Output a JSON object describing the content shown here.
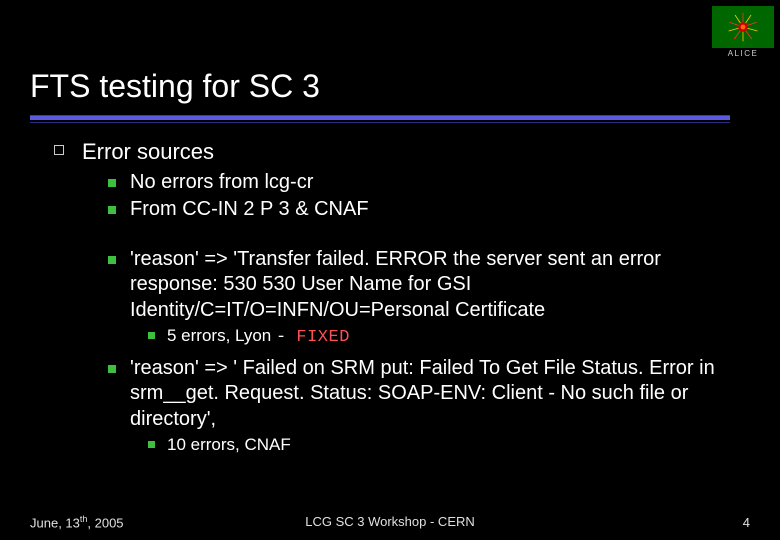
{
  "logo_text": "ALICE",
  "title": "FTS testing for SC 3",
  "lvl1_text": "Error sources",
  "points": {
    "p0": "No errors from lcg-cr",
    "p1": "From CC-IN 2 P 3 & CNAF",
    "p2": "'reason' => 'Transfer failed. ERROR the server sent an error response: 530 530 User Name for GSI Identity/C=IT/O=INFN/OU=Personal Certificate",
    "p2_sub_a": "5 errors, Lyon ",
    "p2_sub_sep": "- ",
    "p2_sub_b": "FIXED",
    "p3": "'reason' => ' Failed on SRM put: Failed To Get File Status. Error in srm__get. Request. Status: SOAP-ENV: Client - No such file or directory',",
    "p3_sub": "10 errors, CNAF"
  },
  "footer": {
    "left_pre": "June, 13",
    "left_sup": "th",
    "left_post": ", 2005",
    "center": "LCG SC 3 Workshop - CERN",
    "right": "4"
  }
}
